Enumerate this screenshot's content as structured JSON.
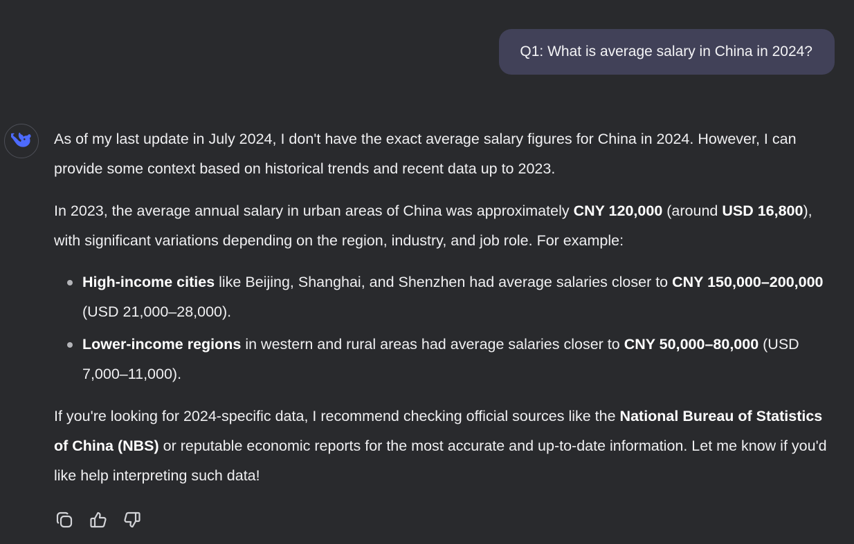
{
  "user_message": {
    "text": "Q1: What is average salary in China in 2024?"
  },
  "assistant": {
    "avatar_icon": "deepseek-whale-icon",
    "brand_color": "#4d6bfe",
    "paragraph1": "As of my last update in July 2024, I don't have the exact average salary figures for China in 2024. However, I can provide some context based on historical trends and recent data up to 2023.",
    "paragraph2": {
      "text_a": "In 2023, the average annual salary in urban areas of China was approximately ",
      "bold_a": "CNY 120,000",
      "text_b": " (around ",
      "bold_b": "USD 16,800",
      "text_c": "), with significant variations depending on the region, industry, and job role. For example:"
    },
    "bullets": [
      {
        "bold_a": "High-income cities",
        "text_a": " like Beijing, Shanghai, and Shenzhen had average salaries closer to ",
        "bold_b": "CNY 150,000–200,000",
        "text_b": " (USD 21,000–28,000)."
      },
      {
        "bold_a": "Lower-income regions",
        "text_a": " in western and rural areas had average salaries closer to ",
        "bold_b": "CNY 50,000–80,000",
        "text_b": " (USD 7,000–11,000)."
      }
    ],
    "paragraph3": {
      "text_a": "If you're looking for 2024-specific data, I recommend checking official sources like the ",
      "bold_a": "National Bureau of Statistics of China (NBS)",
      "text_b": " or reputable economic reports for the most accurate and up-to-date information. Let me know if you'd like help interpreting such data!"
    }
  },
  "actions": {
    "icons": [
      "copy-icon",
      "thumbs-up-icon",
      "thumbs-down-icon"
    ]
  }
}
